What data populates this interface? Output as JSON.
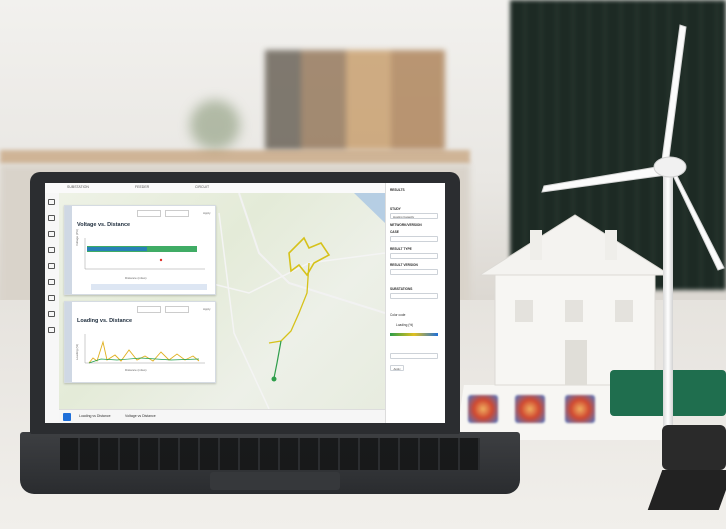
{
  "screen": {
    "breadcrumb": [
      "SUBSTATION",
      "FEEDER",
      "CIRCUIT"
    ],
    "panel1": {
      "title": "Voltage vs. Distance",
      "apply": "Apply",
      "y_label": "Voltage (PU)",
      "x_label": "Distance (miles)"
    },
    "panel2": {
      "title": "Loading vs. Distance",
      "apply": "Apply",
      "y_label": "Loading (%)",
      "x_label": "Distance (miles)"
    },
    "right_panel": {
      "header": "RESULTS",
      "study_label": "STUDY",
      "study_value": "Hosting Capacity",
      "network_label": "NETWORK/VERSION",
      "case_label": "CASE",
      "result_type_label": "RESULT TYPE",
      "result_version_label": "RESULT VERSION",
      "substations_label": "SUBSTATIONS",
      "color_label": "Color code",
      "metric": "Loading (%)",
      "apply": "Apply"
    },
    "bottom_tabs": [
      "Loading vs Distance",
      "Voltage vs Distance"
    ],
    "colors": {
      "accent": "#1e6fd9",
      "voltage_series": "#1e9e4a",
      "loading_series": "#e0b020",
      "feeder": "#d6c21a"
    }
  }
}
